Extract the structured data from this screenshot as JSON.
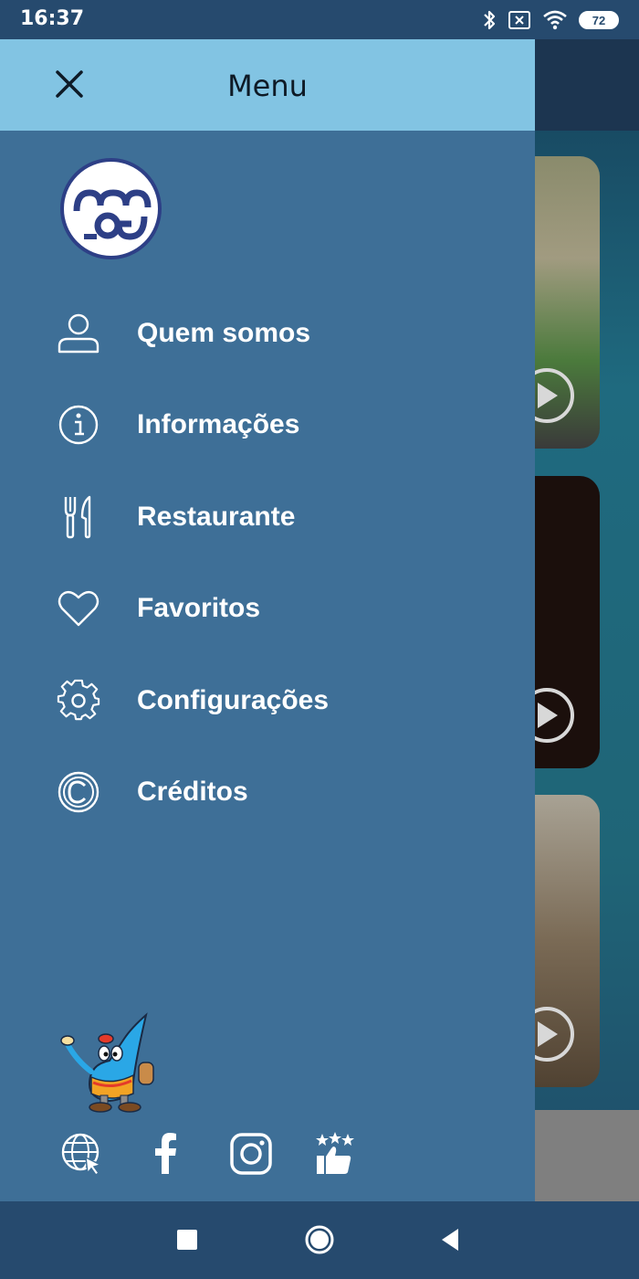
{
  "status_bar": {
    "time": "16:37",
    "battery": "72",
    "icons": [
      "bluetooth-icon",
      "no-sim-icon",
      "wifi-icon",
      "battery-icon"
    ]
  },
  "drawer": {
    "title": "Menu",
    "close_icon": "close-icon",
    "logo_icon": "brand-logo-icon",
    "items": [
      {
        "label": "Quem somos",
        "icon": "user-icon"
      },
      {
        "label": "Informações",
        "icon": "info-icon"
      },
      {
        "label": "Restaurante",
        "icon": "fork-knife-icon"
      },
      {
        "label": "Favoritos",
        "icon": "heart-icon"
      },
      {
        "label": "Configurações",
        "icon": "gear-icon"
      },
      {
        "label": "Créditos",
        "icon": "copyright-icon"
      }
    ],
    "mascot_icon": "water-drop-mascot-icon",
    "social": [
      "globe-icon",
      "facebook-icon",
      "instagram-icon",
      "rating-thumbs-up-icon"
    ]
  },
  "nav_bar": {
    "buttons": [
      "recent-apps-icon",
      "home-icon",
      "back-icon"
    ]
  },
  "colors": {
    "drawer_bg": "#3e6f97",
    "drawer_header": "#82c4e3",
    "system_bar": "#264a6e",
    "logo_ring": "#2d3f86"
  }
}
